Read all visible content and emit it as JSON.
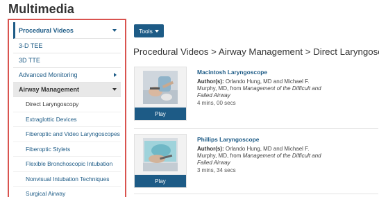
{
  "page_title": "Multimedia",
  "sidebar": {
    "items": [
      {
        "label": "Procedural Videos"
      },
      {
        "label": "3-D TEE"
      },
      {
        "label": "3D TTE"
      },
      {
        "label": "Advanced Monitoring"
      },
      {
        "label": "Airway Management"
      }
    ],
    "subitems": [
      {
        "label": "Direct Laryngoscopy"
      },
      {
        "label": "Extraglottic Devices"
      },
      {
        "label": "Fiberoptic and Video Laryngoscopes"
      },
      {
        "label": "Fiberoptic Stylets"
      },
      {
        "label": "Flexible Bronchoscopic Intubation"
      },
      {
        "label": "Nonvisual Intubation Techniques"
      },
      {
        "label": "Surgical Airway"
      }
    ]
  },
  "toolbar": {
    "tools_label": "Tools"
  },
  "section_title": "Procedural Videos > Airway Management > Direct Laryngoscopy",
  "videos": [
    {
      "title": "Macintosh Laryngoscope",
      "authors_label": "Author(s):",
      "authors": "Orlando Hung, MD and Michael F. Murphy, MD, from",
      "source": "Management of the Difficult and Failed Airway",
      "duration": "4 mins, 00 secs",
      "play_label": "Play"
    },
    {
      "title": "Phillips Laryngoscope",
      "authors_label": "Author(s):",
      "authors": "Orlando Hung, MD and Michael F. Murphy, MD, from",
      "source": "Management of the Difficult and Failed Airway",
      "duration": "3 mins, 34 secs",
      "play_label": "Play"
    }
  ],
  "colors": {
    "accent": "#1d5b86",
    "highlight_border": "#d9534f"
  }
}
